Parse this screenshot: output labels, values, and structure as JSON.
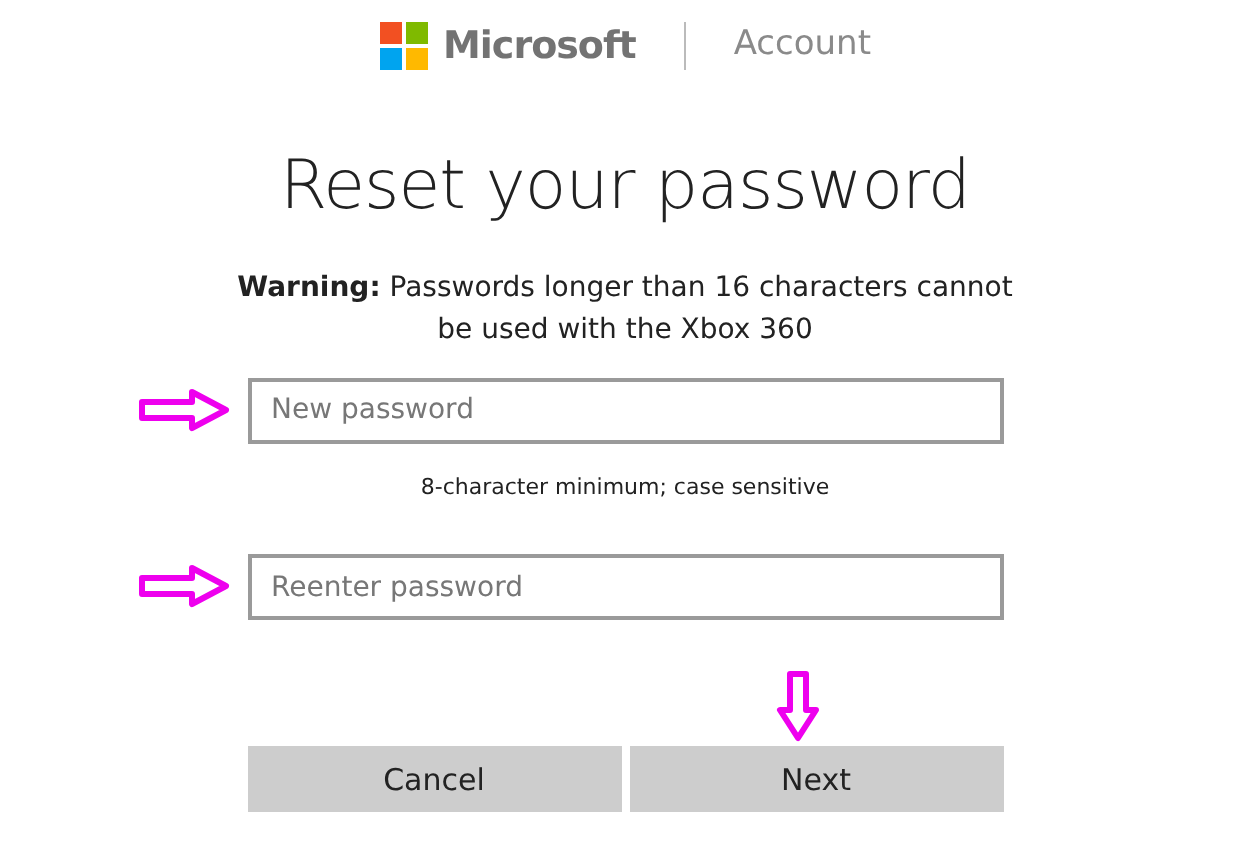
{
  "header": {
    "brand": "Microsoft",
    "section": "Account"
  },
  "title": "Reset your password",
  "warning": "**Warning:** Passwords longer than 16 characters cannot be used with the Xbox 360",
  "fields": [
    {
      "placeholder": "New password",
      "hint": "8-character minimum; case sensitive"
    },
    {
      "placeholder": "Reenter password"
    }
  ],
  "buttons": [
    {
      "label": "Cancel"
    },
    {
      "label": "Next"
    }
  ]
}
